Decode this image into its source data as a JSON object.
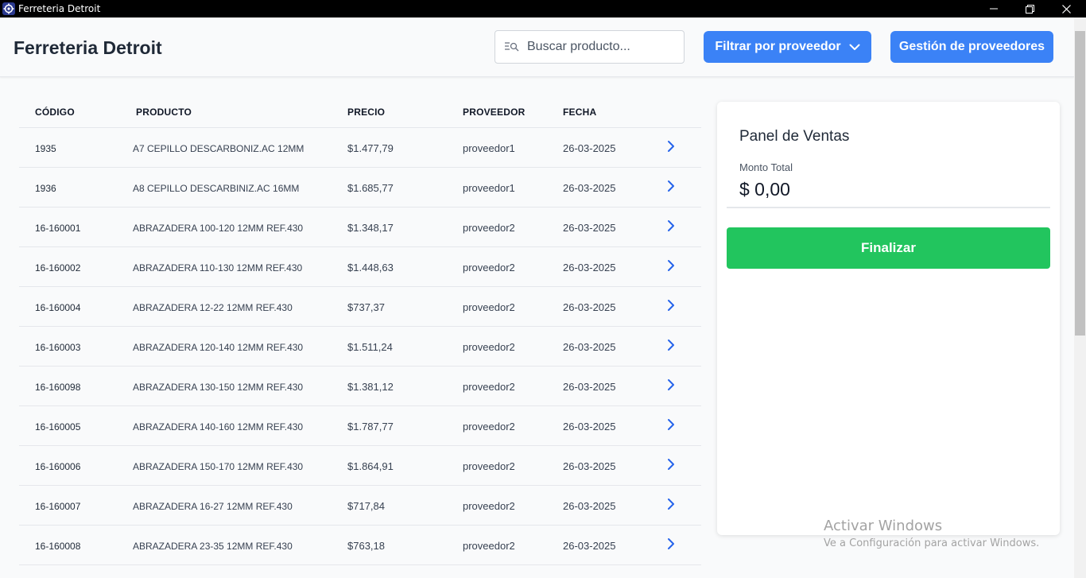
{
  "window": {
    "title": "Ferreteria Detroit",
    "icon": "gear-icon"
  },
  "header": {
    "brand": "Ferreteria Detroit",
    "search_placeholder": "Buscar producto...",
    "search_value": "",
    "filter_label": "Filtrar por proveedor",
    "providers_label": "Gestión de proveedores",
    "accent_color": "#3b82f6"
  },
  "table": {
    "headers": {
      "codigo": "CÓDIGO",
      "producto": "PRODUCTO",
      "precio": "PRECIO",
      "proveedor": "PROVEEDOR",
      "fecha": "FECHA"
    },
    "rows": [
      {
        "codigo": "1935",
        "producto": "A7 CEPILLO DESCARBONIZ.AC 12MM",
        "precio": "$1.477,79",
        "proveedor": "proveedor1",
        "fecha": "26-03-2025"
      },
      {
        "codigo": "1936",
        "producto": "A8 CEPILLO DESCARBINIZ.AC 16MM",
        "precio": "$1.685,77",
        "proveedor": "proveedor1",
        "fecha": "26-03-2025"
      },
      {
        "codigo": "16-160001",
        "producto": "ABRAZADERA 100-120 12MM REF.430",
        "precio": "$1.348,17",
        "proveedor": "proveedor2",
        "fecha": "26-03-2025"
      },
      {
        "codigo": "16-160002",
        "producto": "ABRAZADERA 110-130 12MM REF.430",
        "precio": "$1.448,63",
        "proveedor": "proveedor2",
        "fecha": "26-03-2025"
      },
      {
        "codigo": "16-160004",
        "producto": "ABRAZADERA 12-22 12MM REF.430",
        "precio": "$737,37",
        "proveedor": "proveedor2",
        "fecha": "26-03-2025"
      },
      {
        "codigo": "16-160003",
        "producto": "ABRAZADERA 120-140 12MM REF.430",
        "precio": "$1.511,24",
        "proveedor": "proveedor2",
        "fecha": "26-03-2025"
      },
      {
        "codigo": "16-160098",
        "producto": "ABRAZADERA 130-150 12MM REF.430",
        "precio": "$1.381,12",
        "proveedor": "proveedor2",
        "fecha": "26-03-2025"
      },
      {
        "codigo": "16-160005",
        "producto": "ABRAZADERA 140-160 12MM REF.430",
        "precio": "$1.787,77",
        "proveedor": "proveedor2",
        "fecha": "26-03-2025"
      },
      {
        "codigo": "16-160006",
        "producto": "ABRAZADERA 150-170 12MM REF.430",
        "precio": "$1.864,91",
        "proveedor": "proveedor2",
        "fecha": "26-03-2025"
      },
      {
        "codigo": "16-160007",
        "producto": "ABRAZADERA 16-27 12MM REF.430",
        "precio": "$717,84",
        "proveedor": "proveedor2",
        "fecha": "26-03-2025"
      },
      {
        "codigo": "16-160008",
        "producto": "ABRAZADERA 23-35 12MM REF.430",
        "precio": "$763,18",
        "proveedor": "proveedor2",
        "fecha": "26-03-2025"
      }
    ]
  },
  "panel": {
    "title": "Panel de Ventas",
    "monto_label": "Monto Total",
    "monto_value": "$ 0,00",
    "finalizar_label": "Finalizar",
    "finalizar_color": "#22c55e"
  },
  "watermark": {
    "line1": "Activar Windows",
    "line2": "Ve a Configuración para activar Windows."
  }
}
